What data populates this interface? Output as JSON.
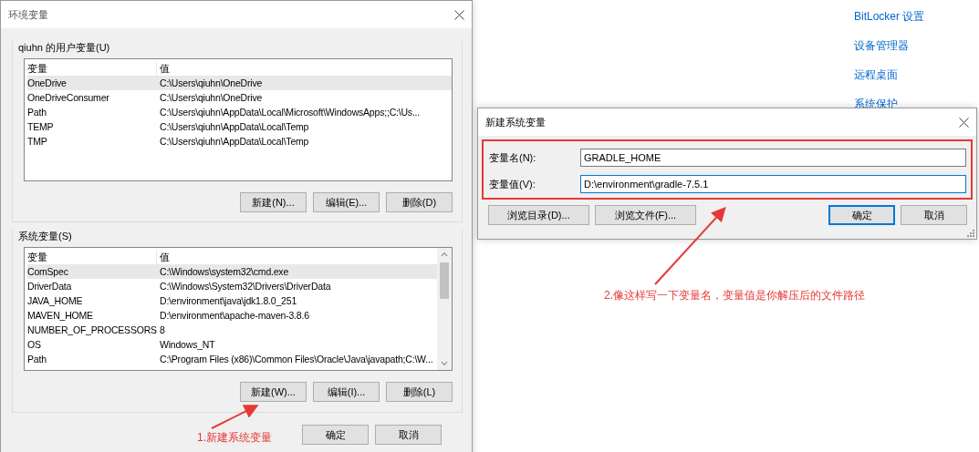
{
  "background_links": [
    {
      "label": "BitLocker 设置"
    },
    {
      "label": "设备管理器"
    },
    {
      "label": "远程桌面"
    },
    {
      "label": "系统保护"
    }
  ],
  "env_dialog": {
    "title": "环境变量",
    "user_vars": {
      "label": "qiuhn 的用户变量(U)",
      "columns": [
        "变量",
        "值"
      ],
      "rows": [
        {
          "name": "OneDrive",
          "value": "C:\\Users\\qiuhn\\OneDrive",
          "selected": true
        },
        {
          "name": "OneDriveConsumer",
          "value": "C:\\Users\\qiuhn\\OneDrive",
          "selected": false
        },
        {
          "name": "Path",
          "value": "C:\\Users\\qiuhn\\AppData\\Local\\Microsoft\\WindowsApps;;C:\\Us...",
          "selected": false
        },
        {
          "name": "TEMP",
          "value": "C:\\Users\\qiuhn\\AppData\\Local\\Temp",
          "selected": false
        },
        {
          "name": "TMP",
          "value": "C:\\Users\\qiuhn\\AppData\\Local\\Temp",
          "selected": false
        }
      ],
      "buttons": [
        "新建(N)...",
        "编辑(E)...",
        "删除(D)"
      ]
    },
    "system_vars": {
      "label": "系统变量(S)",
      "columns": [
        "变量",
        "值"
      ],
      "rows": [
        {
          "name": "ComSpec",
          "value": "C:\\Windows\\system32\\cmd.exe",
          "selected": true
        },
        {
          "name": "DriverData",
          "value": "C:\\Windows\\System32\\Drivers\\DriverData",
          "selected": false
        },
        {
          "name": "JAVA_HOME",
          "value": "D:\\environment\\java\\jdk1.8.0_251",
          "selected": false
        },
        {
          "name": "MAVEN_HOME",
          "value": "D:\\environment\\apache-maven-3.8.6",
          "selected": false
        },
        {
          "name": "NUMBER_OF_PROCESSORS",
          "value": "8",
          "selected": false
        },
        {
          "name": "OS",
          "value": "Windows_NT",
          "selected": false
        },
        {
          "name": "Path",
          "value": "C:\\Program Files (x86)\\Common Files\\Oracle\\Java\\javapath;C:\\W...",
          "selected": false
        }
      ],
      "buttons": [
        "新建(W)...",
        "编辑(I)...",
        "删除(L)"
      ]
    },
    "footer_buttons": [
      "确定",
      "取消"
    ]
  },
  "new_var_dialog": {
    "title": "新建系统变量",
    "highlighted": true,
    "fields": [
      {
        "label": "变量名(N):",
        "value": "GRADLE_HOME",
        "focused": false
      },
      {
        "label": "变量值(V):",
        "value": "D:\\environment\\gradle-7.5.1",
        "focused": true
      }
    ],
    "buttons": [
      {
        "label": "浏览目录(D)...",
        "default": false
      },
      {
        "label": "浏览文件(F)...",
        "default": false
      },
      {
        "label": "确定",
        "default": true
      },
      {
        "label": "取消",
        "default": false
      }
    ]
  },
  "annotations": [
    {
      "text": "1.新建系统变量"
    },
    {
      "text": "2.像这样写一下变量名，变量值是你解压后的文件路径"
    }
  ]
}
